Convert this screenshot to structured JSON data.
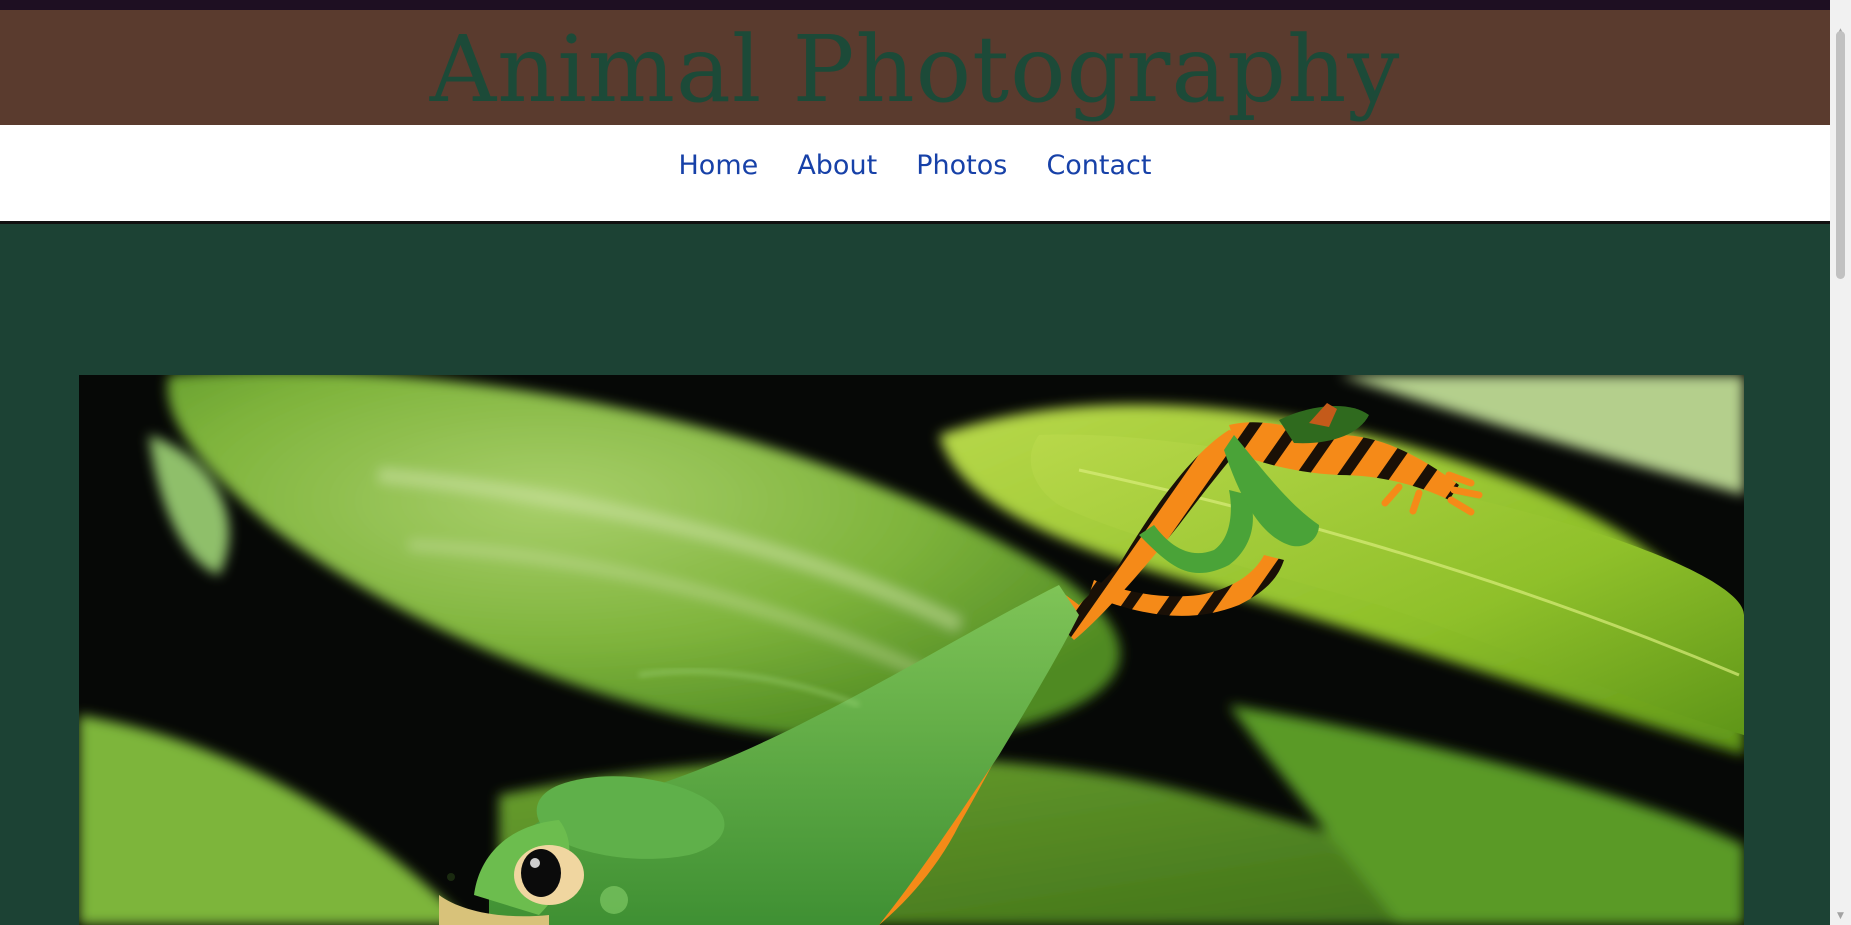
{
  "header": {
    "title": "Animal Photography"
  },
  "nav": {
    "items": [
      {
        "label": "Home"
      },
      {
        "label": "About"
      },
      {
        "label": "Photos"
      },
      {
        "label": "Contact"
      }
    ]
  },
  "colors": {
    "top_bar": "#1e0f22",
    "banner_bg": "#5a3b2e",
    "title_text": "#1c4a38",
    "nav_bg": "#ffffff",
    "nav_link": "#1741a8",
    "main_bg": "#1c4234"
  },
  "hero": {
    "subject": "tiger-legged tree frog on leaf"
  },
  "scrollbar": {
    "up_icon": "chevron-up-icon",
    "down_icon": "chevron-down-icon"
  }
}
